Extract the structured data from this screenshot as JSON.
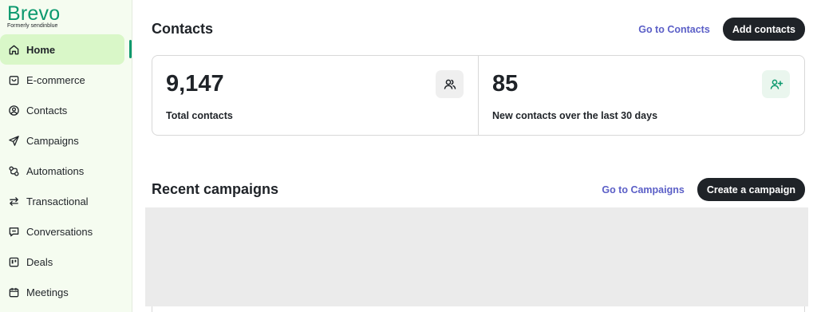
{
  "brand": {
    "name": "Brevo",
    "subtitle": "Formerly sendinblue"
  },
  "sidebar": {
    "items": [
      {
        "label": "Home",
        "icon": "home-icon",
        "active": true
      },
      {
        "label": "E-commerce",
        "icon": "shopping-bag-icon"
      },
      {
        "label": "Contacts",
        "icon": "user-circle-icon"
      },
      {
        "label": "Campaigns",
        "icon": "send-icon"
      },
      {
        "label": "Automations",
        "icon": "automation-icon"
      },
      {
        "label": "Transactional",
        "icon": "transfer-arrows-icon"
      },
      {
        "label": "Conversations",
        "icon": "chat-bubble-icon"
      },
      {
        "label": "Deals",
        "icon": "kanban-icon"
      },
      {
        "label": "Meetings",
        "icon": "calendar-icon"
      }
    ]
  },
  "contacts": {
    "title": "Contacts",
    "go_link": "Go to Contacts",
    "add_button": "Add contacts",
    "stats": [
      {
        "value": "9,147",
        "label": "Total contacts",
        "icon": "users-icon"
      },
      {
        "value": "85",
        "label": "New contacts over the last 30 days",
        "icon": "user-plus-icon"
      }
    ]
  },
  "campaigns": {
    "title": "Recent campaigns",
    "go_link": "Go to Campaigns",
    "create_button": "Create a campaign"
  },
  "colors": {
    "brand": "#0b996e",
    "link": "#5b5fc7",
    "sidebar_bg": "#f5fcf0",
    "active_bg": "#d9f7c8",
    "dark_button": "#1f2328"
  }
}
